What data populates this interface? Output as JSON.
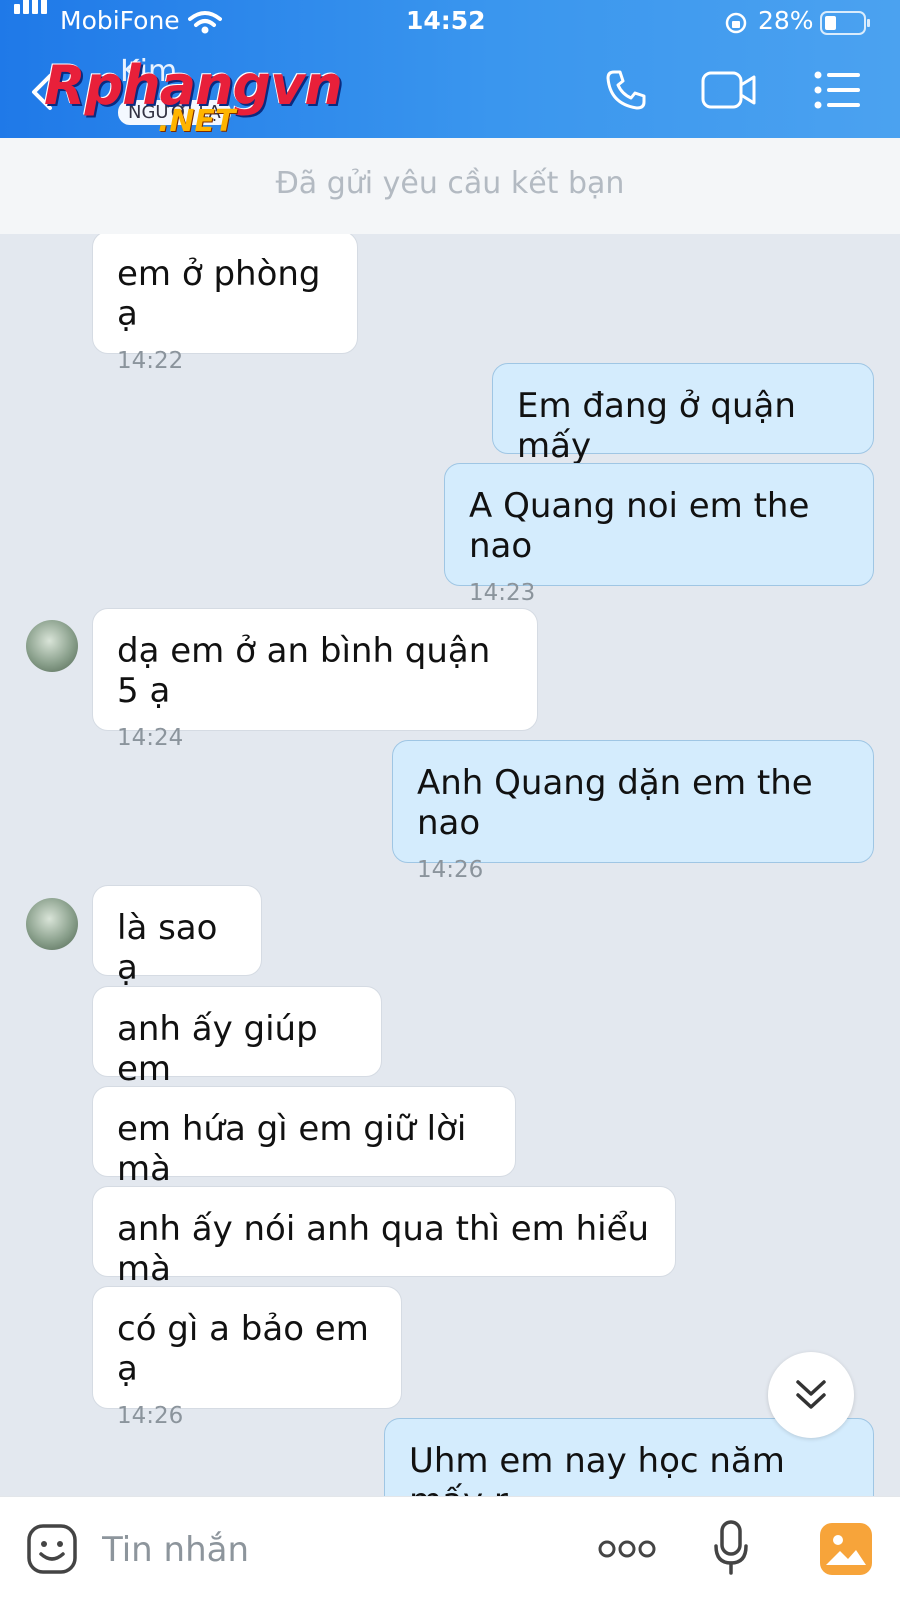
{
  "status_bar": {
    "carrier": "MobiFone",
    "time": "14:52",
    "battery": "28%"
  },
  "header": {
    "contact_name": "Kim",
    "contact_subtitle": "NGƯỜI LẠ",
    "watermark_main": "Rphangvn",
    "watermark_sub": ".NET"
  },
  "banner": {
    "text": "Đã gửi yêu cầu kết bạn"
  },
  "messages": [
    {
      "side": "in",
      "text": "em ở phòng ạ",
      "time": "14:22"
    },
    {
      "side": "out",
      "text": "Em đang ở quận mấy",
      "time": ""
    },
    {
      "side": "out",
      "text": "A Quang noi em the nao",
      "time": "14:23"
    },
    {
      "side": "in",
      "text": "dạ em ở an bình quận 5 ạ",
      "time": "14:24"
    },
    {
      "side": "out",
      "text": "Anh Quang dặn em the nao",
      "time": "14:26"
    },
    {
      "side": "in",
      "text": "là sao ạ",
      "time": ""
    },
    {
      "side": "in",
      "text": "anh ấy giúp em",
      "time": ""
    },
    {
      "side": "in",
      "text": "em hứa gì em giữ lời mà",
      "time": ""
    },
    {
      "side": "in",
      "text": "anh ấy nói anh qua thì em hiểu mà",
      "time": ""
    },
    {
      "side": "in",
      "text": "có gì a bảo em ạ",
      "time": "14:26"
    },
    {
      "side": "out",
      "text": "Uhm em nay học năm mấy r",
      "time": ""
    }
  ],
  "composer": {
    "placeholder": "Tin nhắn"
  },
  "icons": {
    "signal": "signal-icon",
    "wifi": "wifi-icon",
    "lock_rotation": "rotation-lock-icon",
    "battery": "battery-icon",
    "back": "back-icon",
    "phone": "phone-icon",
    "video": "video-icon",
    "menu": "menu-icon",
    "scroll_down": "double-chevron-down-icon",
    "emoji": "emoji-icon",
    "more": "more-icon",
    "mic": "mic-icon",
    "image": "image-icon"
  },
  "colors": {
    "header": "#2b8aec",
    "outgoing_bubble": "#d4ecfd",
    "incoming_bubble": "#ffffff",
    "chat_bg": "#e3e8ef",
    "image_icon": "#f7a43a"
  }
}
